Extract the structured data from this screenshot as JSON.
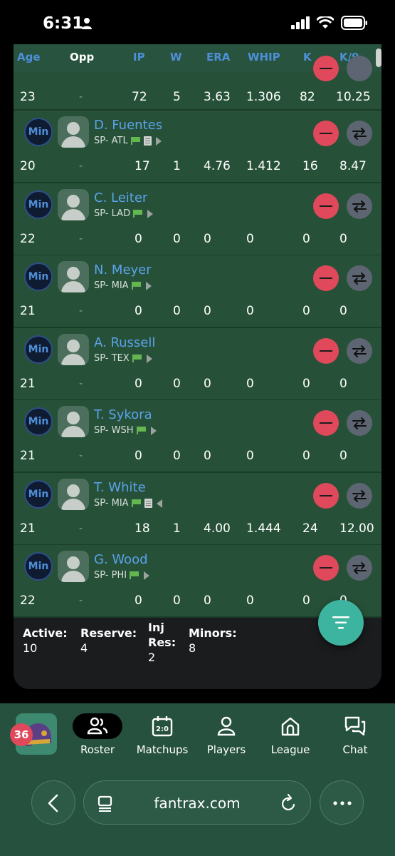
{
  "status_bar": {
    "time": "6:31"
  },
  "table": {
    "headers": [
      "Age",
      "Opp",
      "IP",
      "W",
      "ERA",
      "WHIP",
      "K",
      "K/9"
    ],
    "partial_row": {
      "age": "23",
      "opp": "-",
      "ip": "72",
      "w": "5",
      "era": "3.63",
      "whip": "1.306",
      "k": "82",
      "k9": "10.25"
    },
    "players": [
      {
        "status": "Min",
        "name": "D. Fuentes",
        "info": "SP- ATL",
        "note": true,
        "arrow": "right",
        "age": "20",
        "opp": "-",
        "ip": "17",
        "w": "1",
        "era": "4.76",
        "whip": "1.412",
        "k": "16",
        "k9": "8.47"
      },
      {
        "status": "Min",
        "name": "C. Leiter",
        "info": "SP- LAD",
        "note": false,
        "arrow": "right",
        "age": "22",
        "opp": "-",
        "ip": "0",
        "w": "0",
        "era": "0",
        "whip": "0",
        "k": "0",
        "k9": "0"
      },
      {
        "status": "Min",
        "name": "N. Meyer",
        "info": "SP- MIA",
        "note": false,
        "arrow": "right",
        "age": "21",
        "opp": "-",
        "ip": "0",
        "w": "0",
        "era": "0",
        "whip": "0",
        "k": "0",
        "k9": "0"
      },
      {
        "status": "Min",
        "name": "A. Russell",
        "info": "SP- TEX",
        "note": false,
        "arrow": "right",
        "age": "21",
        "opp": "-",
        "ip": "0",
        "w": "0",
        "era": "0",
        "whip": "0",
        "k": "0",
        "k9": "0"
      },
      {
        "status": "Min",
        "name": "T. Sykora",
        "info": "SP- WSH",
        "note": false,
        "arrow": "right",
        "age": "21",
        "opp": "-",
        "ip": "0",
        "w": "0",
        "era": "0",
        "whip": "0",
        "k": "0",
        "k9": "0"
      },
      {
        "status": "Min",
        "name": "T. White",
        "info": "SP- MIA",
        "note": true,
        "arrow": "left",
        "age": "21",
        "opp": "-",
        "ip": "18",
        "w": "1",
        "era": "4.00",
        "whip": "1.444",
        "k": "24",
        "k9": "12.00"
      },
      {
        "status": "Min",
        "name": "G. Wood",
        "info": "SP- PHI",
        "note": false,
        "arrow": "right",
        "age": "22",
        "opp": "-",
        "ip": "0",
        "w": "0",
        "era": "0",
        "whip": "0",
        "k": "0",
        "k9": "0"
      }
    ]
  },
  "summary": {
    "active_label": "Active:",
    "active_value": "10",
    "reserve_label": "Reserve:",
    "reserve_value": "4",
    "injres_label_1": "Inj",
    "injres_label_2": "Res:",
    "injres_value": "2",
    "minors_label": "Minors:",
    "minors_value": "8"
  },
  "bottom_nav": {
    "badge_count": "36",
    "items": [
      "Roster",
      "Matchups",
      "Players",
      "League",
      "Chat"
    ]
  },
  "browser": {
    "url": "fantrax.com"
  },
  "colors": {
    "accent_blue": "#4f8fd8",
    "row_green": "#265138",
    "drop_red": "#e0485b",
    "fab_teal": "#3db49f"
  }
}
